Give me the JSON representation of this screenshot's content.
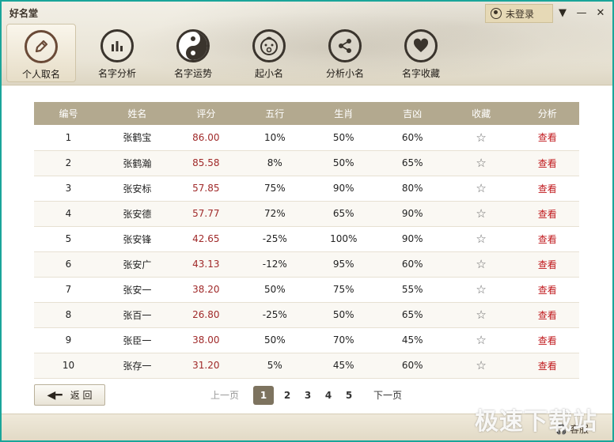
{
  "app": {
    "title": "好名堂"
  },
  "login": {
    "label": "未登录"
  },
  "window_controls": {
    "menu": "▼",
    "minimize": "—",
    "close": "✕"
  },
  "nav": [
    {
      "label": "个人取名",
      "icon": "pencil-icon",
      "active": true
    },
    {
      "label": "名字分析",
      "icon": "bar-chart-icon",
      "active": false
    },
    {
      "label": "名字运势",
      "icon": "yin-yang-icon",
      "active": false
    },
    {
      "label": "起小名",
      "icon": "baby-face-icon",
      "active": false
    },
    {
      "label": "分析小名",
      "icon": "share-icon",
      "active": false
    },
    {
      "label": "名字收藏",
      "icon": "heart-icon",
      "active": false
    }
  ],
  "table": {
    "columns": [
      "编号",
      "姓名",
      "评分",
      "五行",
      "生肖",
      "吉凶",
      "收藏",
      "分析"
    ],
    "rows": [
      {
        "id": "1",
        "name": "张鹤宝",
        "score": "86.00",
        "wuxing": "10%",
        "shengxiao": "50%",
        "jixiong": "60%",
        "fav": "☆",
        "action": "查看"
      },
      {
        "id": "2",
        "name": "张鹤瀚",
        "score": "85.58",
        "wuxing": "8%",
        "shengxiao": "50%",
        "jixiong": "65%",
        "fav": "☆",
        "action": "查看"
      },
      {
        "id": "3",
        "name": "张安标",
        "score": "57.85",
        "wuxing": "75%",
        "shengxiao": "90%",
        "jixiong": "80%",
        "fav": "☆",
        "action": "查看"
      },
      {
        "id": "4",
        "name": "张安德",
        "score": "57.77",
        "wuxing": "72%",
        "shengxiao": "65%",
        "jixiong": "90%",
        "fav": "☆",
        "action": "查看"
      },
      {
        "id": "5",
        "name": "张安锋",
        "score": "42.65",
        "wuxing": "-25%",
        "shengxiao": "100%",
        "jixiong": "90%",
        "fav": "☆",
        "action": "查看"
      },
      {
        "id": "6",
        "name": "张安广",
        "score": "43.13",
        "wuxing": "-12%",
        "shengxiao": "95%",
        "jixiong": "60%",
        "fav": "☆",
        "action": "查看"
      },
      {
        "id": "7",
        "name": "张安一",
        "score": "38.20",
        "wuxing": "50%",
        "shengxiao": "75%",
        "jixiong": "55%",
        "fav": "☆",
        "action": "查看"
      },
      {
        "id": "8",
        "name": "张百一",
        "score": "26.80",
        "wuxing": "-25%",
        "shengxiao": "50%",
        "jixiong": "65%",
        "fav": "☆",
        "action": "查看"
      },
      {
        "id": "9",
        "name": "张臣一",
        "score": "38.00",
        "wuxing": "50%",
        "shengxiao": "70%",
        "jixiong": "45%",
        "fav": "☆",
        "action": "查看"
      },
      {
        "id": "10",
        "name": "张存一",
        "score": "31.20",
        "wuxing": "5%",
        "shengxiao": "45%",
        "jixiong": "60%",
        "fav": "☆",
        "action": "查看"
      }
    ]
  },
  "back_button": {
    "label": "返 回"
  },
  "pager": {
    "prev": "上一页",
    "pages": [
      "1",
      "2",
      "3",
      "4",
      "5"
    ],
    "current": "1",
    "next": "下一页"
  },
  "footer": {
    "service": "客服"
  },
  "watermark": {
    "text": "极速下载站"
  },
  "colors": {
    "accent": "#7d735f",
    "header_row": "#b3a98f",
    "score": "#a02a2a",
    "link": "#c0181c",
    "border": "#1aa59a"
  }
}
